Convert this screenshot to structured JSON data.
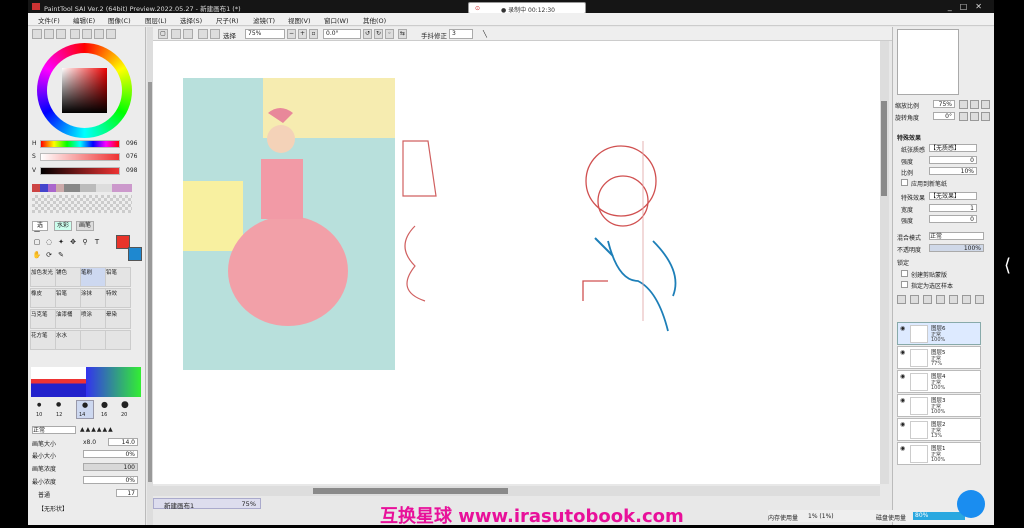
{
  "window": {
    "title": "PaintTool SAI Ver.2 (64bit) Preview.2022.05.27 - 新建画布1 (*)",
    "controls": [
      "_",
      "□",
      "✕"
    ]
  },
  "recorder": {
    "badge": "⊙",
    "text": "● 录制中 00:12:30"
  },
  "menu": [
    "文件(F)",
    "编辑(E)",
    "图像(C)",
    "图层(L)",
    "选择(S)",
    "尺子(R)",
    "滤镜(T)",
    "视图(V)",
    "窗口(W)",
    "其他(O)"
  ],
  "toolbar": {
    "selection_label": "选择",
    "zoom": "75%",
    "angle": "0.0°",
    "stabilizer_label": "手抖修正",
    "stabilizer_value": "3"
  },
  "color": {
    "h_label": "H",
    "h_value": "096",
    "s_label": "S",
    "s_value": "076",
    "v_label": "V",
    "v_value": "098",
    "main": "#e8342a",
    "sub": "#1e88d0"
  },
  "tools": {
    "mode_a": "选",
    "mode_b": "水彩",
    "mode_c": "画笔"
  },
  "brushes": [
    {
      "label": "加色发光"
    },
    {
      "label": "铺色"
    },
    {
      "label": "笔刷"
    },
    {
      "label": "铅笔"
    },
    {
      "label": "橡皮"
    },
    {
      "label": "铅笔"
    },
    {
      "label": "涂抹"
    },
    {
      "label": "特效"
    },
    {
      "label": "马克笔"
    },
    {
      "label": "油漆桶"
    },
    {
      "label": "喷涂"
    },
    {
      "label": "晕染"
    },
    {
      "label": "花方笔"
    },
    {
      "label": "水水"
    },
    {
      "label": ""
    },
    {
      "label": ""
    }
  ],
  "brush_sizes": [
    "10",
    "12",
    "14",
    "16",
    "20"
  ],
  "brush_settings": {
    "blend_mode": "正常",
    "size_label": "画笔大小",
    "size_mult": "x8.0",
    "size_value": "14.0",
    "min_size_label": "最小大小",
    "min_size_value": "0%",
    "density_label": "画笔浓度",
    "density_value": "100",
    "min_density_label": "最小浓度",
    "min_density_value": "0%",
    "texture_label": "普通",
    "texture_value": "17",
    "shape_label": "【无形状】"
  },
  "navigator": {
    "name": "新建画布1",
    "zoom": "75%"
  },
  "right_panel": {
    "zoom_label": "缩放比例",
    "zoom_value": "75%",
    "rotate_label": "旋转角度",
    "rotate_value": "0°",
    "effects_title": "特殊效果",
    "paper_label": "纸张质感",
    "paper_value": "【无质感】",
    "strength_label": "强度",
    "strength_value": "0",
    "scale_label": "比例",
    "scale_value": "10%",
    "apply_brush_label": "应用到新笔纸",
    "watercolor_label": "特殊效果",
    "watercolor_value": "【无效果】",
    "width_label": "宽度",
    "width_value": "1",
    "strength2_label": "强度",
    "strength2_value": "0",
    "blend_label": "混合模式",
    "blend_value": "正常",
    "opacity_label": "不透明度",
    "opacity_value": "100%",
    "lock_label": "锁定",
    "clip_label": "创建剪贴蒙版",
    "ref_label": "指定为选区样本"
  },
  "layers": [
    {
      "name": "图层6",
      "mode": "正常",
      "opacity": "100%",
      "selected": true
    },
    {
      "name": "图层5",
      "mode": "正常",
      "opacity": "77%",
      "selected": false
    },
    {
      "name": "图层4",
      "mode": "正常",
      "opacity": "100%",
      "selected": false
    },
    {
      "name": "图层3",
      "mode": "正常",
      "opacity": "100%",
      "selected": false
    },
    {
      "name": "图层2",
      "mode": "正常",
      "opacity": "13%",
      "selected": false
    },
    {
      "name": "图层1",
      "mode": "正常",
      "opacity": "100%",
      "selected": false
    }
  ],
  "status": {
    "memory_label": "内存使用量",
    "memory_value": "1% (1%)",
    "disk_label": "磁盘使用量",
    "disk_value": "80%"
  },
  "watermark": "互换星球 www.irasutobook.com"
}
